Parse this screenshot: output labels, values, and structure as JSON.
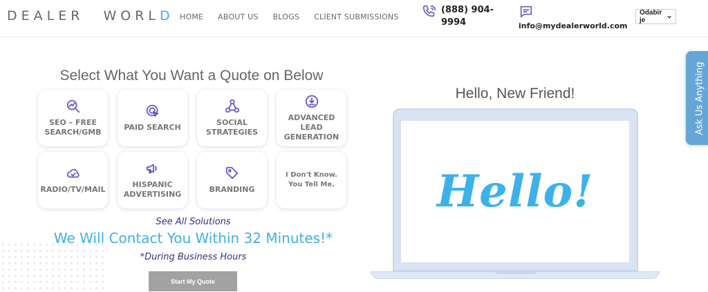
{
  "header": {
    "logo_part1": "DEALER",
    "logo_part2_a": "WORL",
    "logo_part2_b": "D",
    "nav": [
      "HOME",
      "ABOUT US",
      "BLOGS",
      "CLIENT SUBMISSIONS"
    ],
    "phone": "(888) 904-9994",
    "email": "info@mydealerworld.com",
    "language_select": "Odabir je"
  },
  "quote": {
    "title": "Select What You Want a Quote on Below",
    "options": [
      {
        "label": "SEO – FREE SEARCH/GMB",
        "icon": "seo-chart-icon"
      },
      {
        "label": "PAID SEARCH",
        "icon": "click-target-icon"
      },
      {
        "label": "SOCIAL STRATEGIES",
        "icon": "share-network-icon"
      },
      {
        "label": "ADVANCED LEAD GENERATION",
        "icon": "download-circle-icon"
      },
      {
        "label": "RADIO/TV/MAIL",
        "icon": "cloud-check-icon"
      },
      {
        "label": "HISPANIC ADVERTISING",
        "icon": "megaphone-icon"
      },
      {
        "label": "BRANDING",
        "icon": "tag-icon"
      },
      {
        "label": "I Don't Know. You Tell Me.",
        "icon": ""
      }
    ],
    "see_all": "See All Solutions",
    "contact_line": "We Will Contact You Within 32 Minutes!*",
    "hours_note": "*During Business Hours",
    "start_button": "Start My Quote"
  },
  "hero": {
    "title": "Hello, New Friend!",
    "screen_text": "Hello!"
  },
  "side_tab": "Ask Us Anything",
  "colors": {
    "accent_blue": "#3fb0e6",
    "accent_purple": "#6a57c9",
    "dark_purple": "#3c2f7c"
  }
}
